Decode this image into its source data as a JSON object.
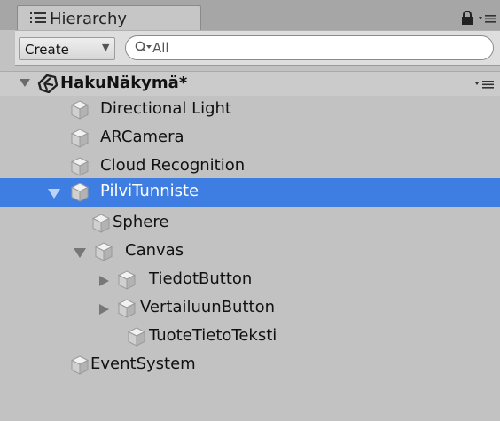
{
  "tab": {
    "title": "Hierarchy"
  },
  "toolbar": {
    "create_label": "Create",
    "search_placeholder": "All"
  },
  "scene": {
    "name": "HakuNäkymä*"
  },
  "rows": [
    {
      "label": "Directional Light"
    },
    {
      "label": "ARCamera"
    },
    {
      "label": "Cloud Recognition"
    },
    {
      "label": "PilviTunniste",
      "selected": true
    },
    {
      "label": "Sphere"
    },
    {
      "label": "Canvas"
    },
    {
      "label": "TiedotButton"
    },
    {
      "label": "VertailuunButton"
    },
    {
      "label": "TuoteTietoTeksti"
    },
    {
      "label": "EventSystem"
    }
  ],
  "colors": {
    "selection": "#3e7de2",
    "panel": "#c2c2c2"
  },
  "icons": {
    "tab": "hierarchy-list-icon",
    "lock": "lock-icon",
    "menu": "context-menu-icon",
    "search": "search-icon",
    "scene": "unity-logo-icon",
    "object": "gameobject-cube-icon"
  }
}
